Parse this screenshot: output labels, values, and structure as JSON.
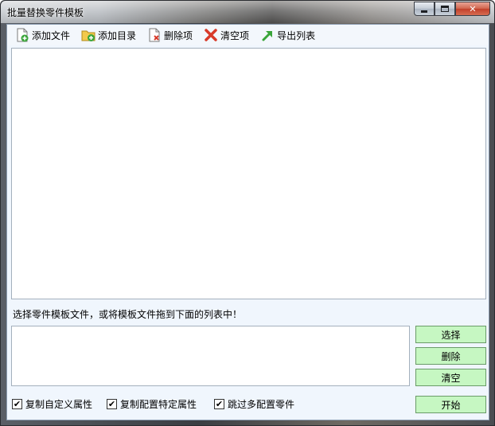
{
  "window": {
    "title": "批量替换零件模板"
  },
  "toolbar": {
    "items": [
      {
        "label": "添加文件",
        "icon": "add-file-icon"
      },
      {
        "label": "添加目录",
        "icon": "add-folder-icon"
      },
      {
        "label": "删除项",
        "icon": "delete-item-icon"
      },
      {
        "label": "清空项",
        "icon": "clear-icon"
      },
      {
        "label": "导出列表",
        "icon": "export-arrow-icon"
      }
    ]
  },
  "hint": "选择零件模板文件，或将模板文件拖到下面的列表中！",
  "buttons": {
    "select": "选择",
    "delete": "删除",
    "clear": "清空",
    "start": "开始"
  },
  "options": [
    {
      "label": "复制自定义属性",
      "checked": true
    },
    {
      "label": "复制配置特定属性",
      "checked": true
    },
    {
      "label": "跳过多配置零件",
      "checked": true
    }
  ],
  "colors": {
    "action_button": "#c6f7c2",
    "client_bg": "#f0f6fd"
  }
}
